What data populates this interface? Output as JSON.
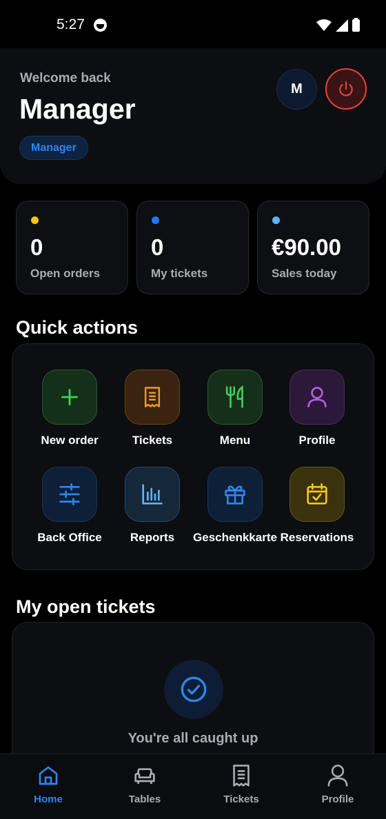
{
  "status_bar": {
    "time": "5:27"
  },
  "header": {
    "welcome": "Welcome back",
    "name": "Manager",
    "role_badge": "Manager",
    "avatar_initial": "M"
  },
  "stats": [
    {
      "value": "0",
      "label": "Open orders",
      "dot_color": "#f5c518"
    },
    {
      "value": "0",
      "label": "My tickets",
      "dot_color": "#1e7bf0"
    },
    {
      "value": "€90.00",
      "label": "Sales today",
      "dot_color": "#5ab6f5"
    }
  ],
  "quick_actions": {
    "title": "Quick actions",
    "items": [
      {
        "label": "New order",
        "icon": "plus-icon",
        "color": "#3fd15a"
      },
      {
        "label": "Tickets",
        "icon": "receipt-icon",
        "color": "#f0982a"
      },
      {
        "label": "Menu",
        "icon": "fork-knife-icon",
        "color": "#3fd15a"
      },
      {
        "label": "Profile",
        "icon": "user-icon",
        "color": "#b35de0"
      },
      {
        "label": "Back Office",
        "icon": "sliders-icon",
        "color": "#2e86f0"
      },
      {
        "label": "Reports",
        "icon": "bar-chart-icon",
        "color": "#5ab6f5"
      },
      {
        "label": "Geschenkkarte",
        "icon": "gift-icon",
        "color": "#2e86f0"
      },
      {
        "label": "Reservations",
        "icon": "calendar-check-icon",
        "color": "#f5c518"
      }
    ]
  },
  "open_tickets": {
    "title": "My open tickets",
    "empty_message": "You're all caught up"
  },
  "bottom_nav": {
    "items": [
      {
        "label": "Home",
        "icon": "home-icon",
        "active": true
      },
      {
        "label": "Tables",
        "icon": "sofa-icon",
        "active": false
      },
      {
        "label": "Tickets",
        "icon": "receipt-icon",
        "active": false
      },
      {
        "label": "Profile",
        "icon": "user-icon",
        "active": false
      }
    ]
  },
  "colors": {
    "accent": "#2e86f0",
    "danger": "#e0463c"
  }
}
